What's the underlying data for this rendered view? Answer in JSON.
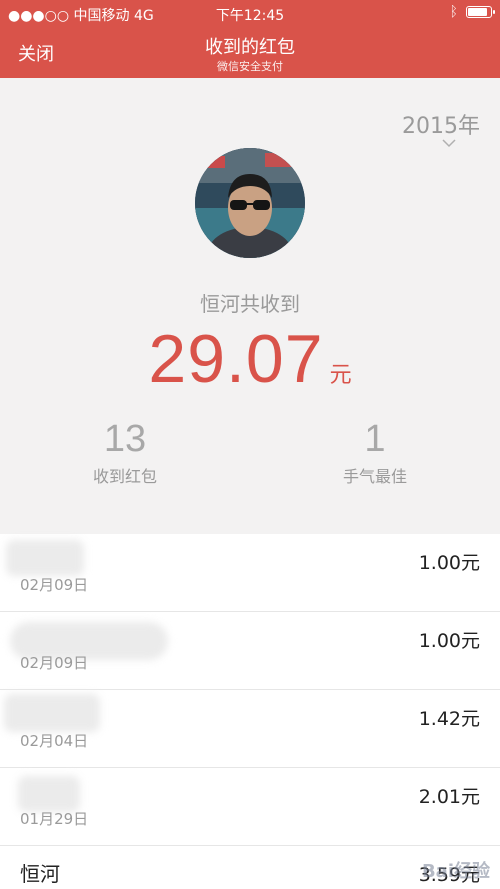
{
  "status_bar": {
    "carrier": "●●●○○ 中国移动  4G",
    "time": "下午12:45"
  },
  "nav": {
    "close_label": "关闭",
    "title": "收到的红包",
    "subtitle": "微信安全支付"
  },
  "summary": {
    "year": "2015年",
    "received_label": "恒河共收到",
    "amount": "29.07",
    "unit": "元",
    "stats": [
      {
        "value": "13",
        "label": "收到红包"
      },
      {
        "value": "1",
        "label": "手气最佳"
      }
    ]
  },
  "records": [
    {
      "name": "",
      "date": "02月09日",
      "amount": "1.00元"
    },
    {
      "name": "",
      "date": "02月09日",
      "amount": "1.00元"
    },
    {
      "name": "",
      "date": "02月04日",
      "amount": "1.42元"
    },
    {
      "name": "",
      "date": "01月29日",
      "amount": "2.01元"
    },
    {
      "name": "恒河",
      "date": "",
      "amount": "3.59元"
    }
  ],
  "watermark": "Bai经验"
}
